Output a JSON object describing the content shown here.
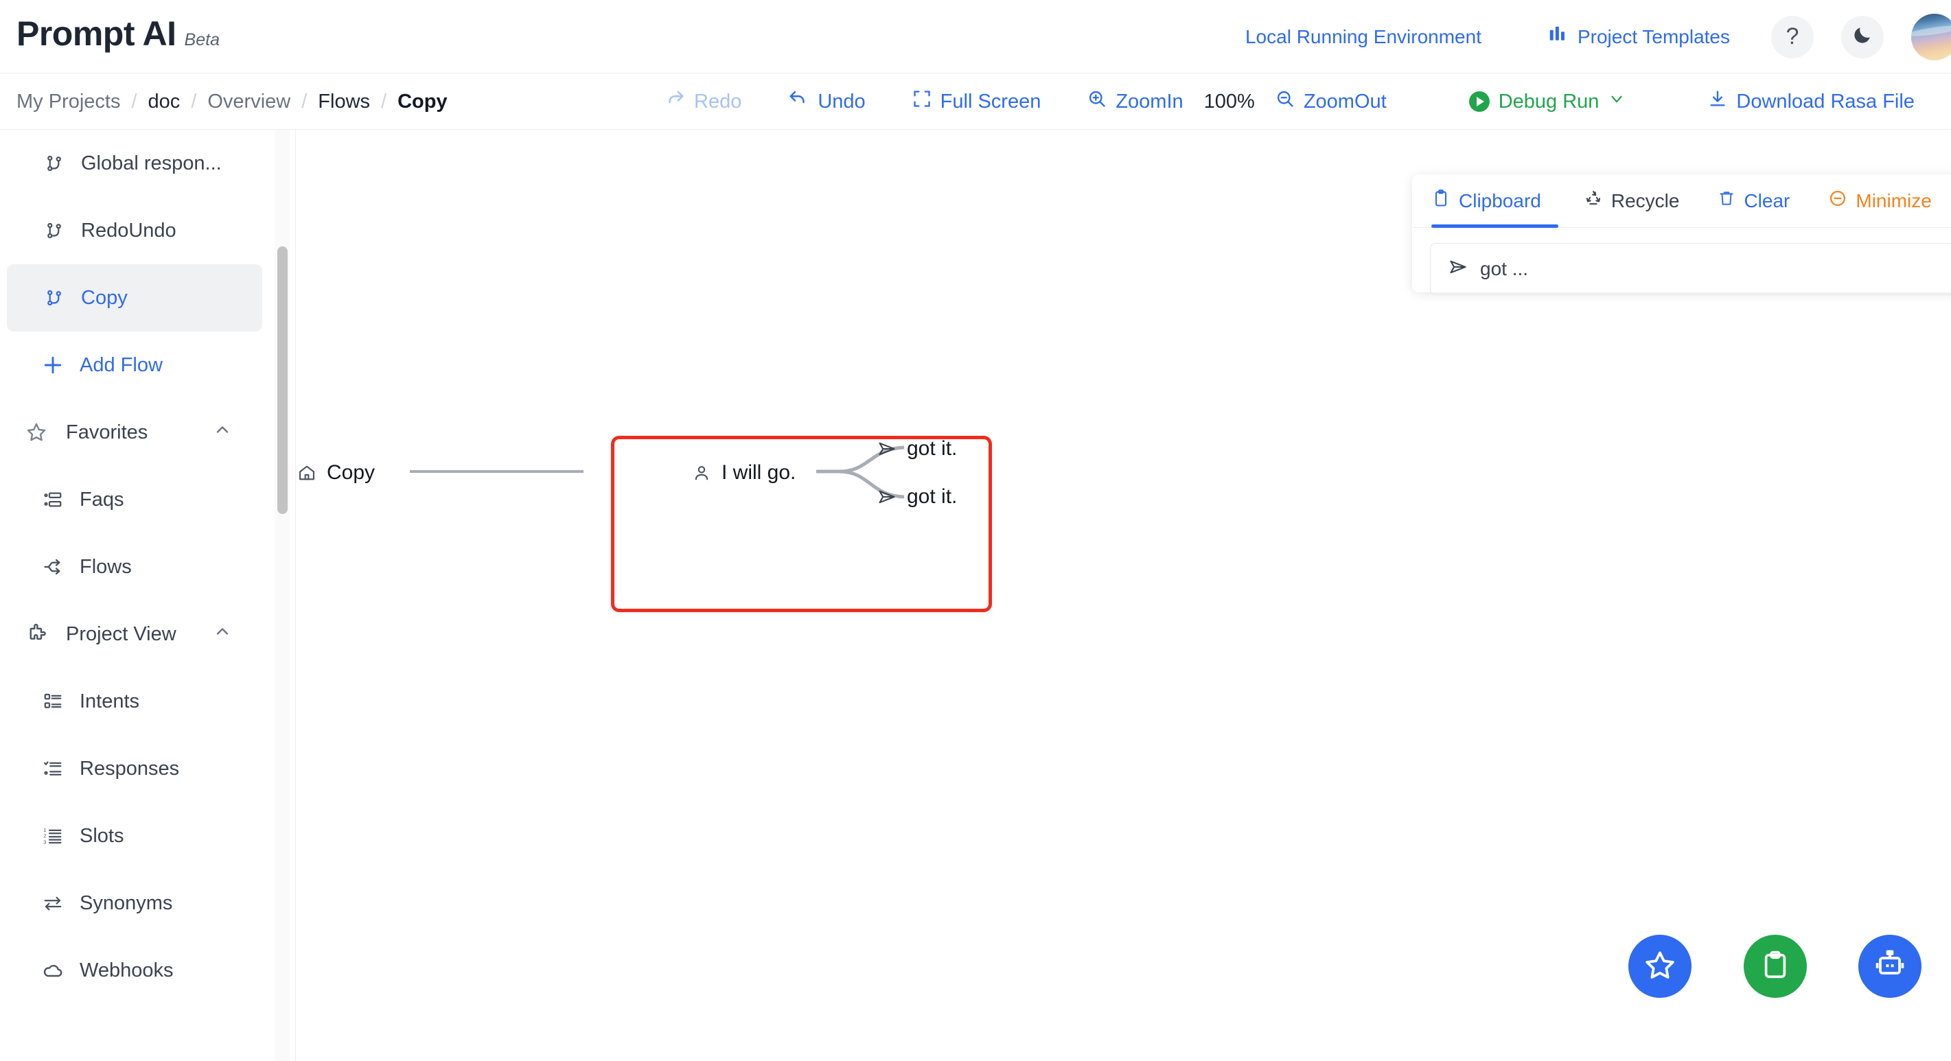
{
  "header": {
    "brand_name": "Prompt AI",
    "brand_tag": "Beta",
    "env_link": "Local Running Environment",
    "templates_link": "Project Templates",
    "help_glyph": "?",
    "icons": {
      "templates": "chart-bars-icon",
      "help": "question-mark-icon",
      "theme": "moon-icon",
      "avatar": "user-avatar"
    }
  },
  "toolbar": {
    "breadcrumb": [
      {
        "label": "My Projects",
        "style": "muted"
      },
      {
        "label": "doc",
        "style": "strong"
      },
      {
        "label": "Overview",
        "style": "muted"
      },
      {
        "label": "Flows",
        "style": "strong"
      },
      {
        "label": "Copy",
        "style": "current"
      }
    ],
    "separator": "/",
    "redo": "Redo",
    "undo": "Undo",
    "full_screen": "Full Screen",
    "zoom_in": "ZoomIn",
    "zoom_level": "100%",
    "zoom_out": "ZoomOut",
    "debug_run": "Debug Run",
    "download": "Download Rasa File"
  },
  "sidebar": {
    "flows": [
      {
        "label": "Global respon...",
        "icon": "git-branch-icon",
        "active": false
      },
      {
        "label": "RedoUndo",
        "icon": "git-branch-icon",
        "active": false
      },
      {
        "label": "Copy",
        "icon": "git-branch-icon",
        "active": true
      }
    ],
    "add_flow": "Add Flow",
    "favorites": {
      "label": "Favorites",
      "items": [
        {
          "label": "Faqs",
          "icon": "list-check-icon"
        },
        {
          "label": "Flows",
          "icon": "flow-branch-icon"
        }
      ]
    },
    "project_view": {
      "label": "Project View",
      "items": [
        {
          "label": "Intents",
          "icon": "list-boxes-icon"
        },
        {
          "label": "Responses",
          "icon": "list-check-icon"
        },
        {
          "label": "Slots",
          "icon": "list-numbered-icon"
        },
        {
          "label": "Synonyms",
          "icon": "swap-arrows-icon"
        },
        {
          "label": "Webhooks",
          "icon": "cloud-icon"
        }
      ]
    }
  },
  "flow": {
    "start_node": {
      "label": "Copy",
      "icon": "home-icon"
    },
    "user_node": {
      "label": "I will go.",
      "icon": "user-icon"
    },
    "bot_nodes": [
      {
        "label": "got it.",
        "icon": "send-icon"
      },
      {
        "label": "got it.",
        "icon": "send-icon"
      }
    ],
    "selection_color": "#f02c1e"
  },
  "clipboard": {
    "tabs": [
      {
        "label": "Clipboard",
        "icon": "clipboard-icon",
        "state": "active"
      },
      {
        "label": "Recycle",
        "icon": "recycle-icon",
        "state": "plain"
      },
      {
        "label": "Clear",
        "icon": "trash-icon",
        "state": "blue"
      },
      {
        "label": "Minimize",
        "icon": "minus-circle-icon",
        "state": "orange"
      }
    ],
    "items": [
      {
        "label": "got ...",
        "icon": "send-icon"
      }
    ]
  },
  "fabs": [
    {
      "name": "favorites-fab",
      "icon": "star-icon",
      "color": "#2f6bf0"
    },
    {
      "name": "clipboard-fab",
      "icon": "clipboard-icon",
      "color": "#22a84a"
    },
    {
      "name": "assistant-fab",
      "icon": "robot-icon",
      "color": "#2f6bf0"
    }
  ]
}
